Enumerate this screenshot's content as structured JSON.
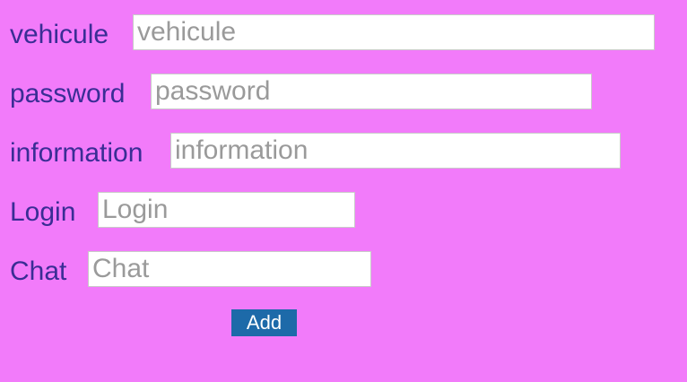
{
  "form": {
    "fields": [
      {
        "label": "vehicule",
        "placeholder": "vehicule",
        "value": ""
      },
      {
        "label": "password",
        "placeholder": "password",
        "value": ""
      },
      {
        "label": "information",
        "placeholder": "information",
        "value": ""
      },
      {
        "label": "Login",
        "placeholder": "Login",
        "value": ""
      },
      {
        "label": "Chat",
        "placeholder": "Chat",
        "value": ""
      }
    ],
    "submit_label": "Add"
  },
  "colors": {
    "background": "#f27bfa",
    "label_text": "#3a2d95",
    "button_background": "#1d6aa9",
    "button_text": "#ffffff",
    "placeholder_text": "#9a9a9a"
  }
}
